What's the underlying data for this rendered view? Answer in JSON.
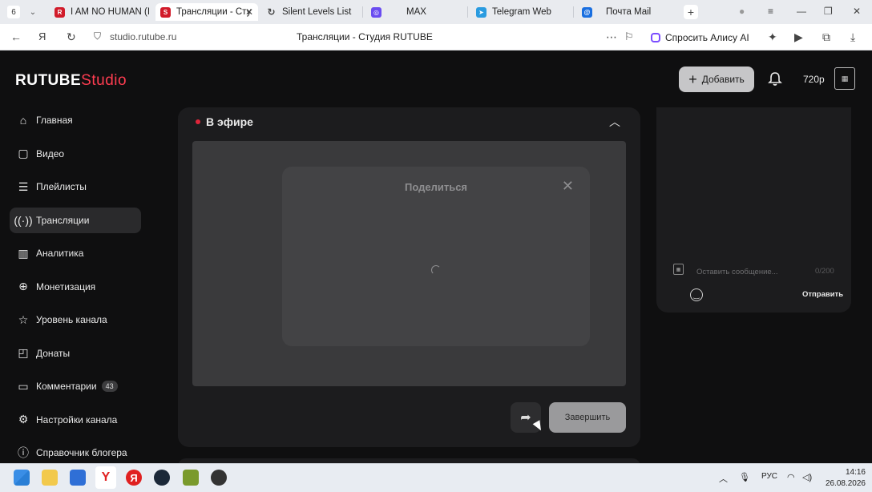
{
  "browser": {
    "tab_counter": "6",
    "tabs": [
      {
        "label": "I AM NO HUMAN (Ir",
        "fav_letter": "R",
        "fav_color": "#d11b2a"
      },
      {
        "label": "Трансляции - Сту",
        "fav_letter": "S",
        "fav_color": "#d11b2a",
        "active": true
      },
      {
        "label": "Silent Levels List",
        "fav_letter": "↻",
        "fav_color": "#444444"
      },
      {
        "label": "MAX",
        "fav_letter": "◎",
        "fav_color": "#6a4cf0"
      },
      {
        "label": "Telegram Web",
        "fav_letter": "➤",
        "fav_color": "#2a9be0"
      },
      {
        "label": "Почта Mail",
        "fav_letter": "@",
        "fav_color": "#1a6fe0"
      }
    ],
    "new_tab": "+",
    "url": "studio.rutube.ru",
    "page_title": "Трансляции - Студия RUTUBE",
    "alice_label": "Спросить Алису AI"
  },
  "header": {
    "logo_main": "RUTUBE",
    "logo_sub": "Studio",
    "add_label": "Добавить",
    "quality": "720p"
  },
  "sidebar": {
    "items": [
      {
        "label": "Главная",
        "icon": "home-icon"
      },
      {
        "label": "Видео",
        "icon": "video-icon"
      },
      {
        "label": "Плейлисты",
        "icon": "playlist-icon"
      },
      {
        "label": "Трансляции",
        "icon": "broadcast-icon",
        "active": true
      },
      {
        "label": "Аналитика",
        "icon": "analytics-icon"
      },
      {
        "label": "Монетизация",
        "icon": "money-icon"
      },
      {
        "label": "Уровень канала",
        "icon": "star-icon"
      },
      {
        "label": "Донаты",
        "icon": "donate-icon"
      },
      {
        "label": "Комментарии",
        "icon": "comment-icon",
        "badge": "43"
      },
      {
        "label": "Настройки канала",
        "icon": "gear-icon"
      },
      {
        "label": "Справочник блогера",
        "icon": "info-icon"
      }
    ]
  },
  "stream": {
    "status": "В эфире",
    "share_title": "Поделиться",
    "finish_label": "Завершить"
  },
  "chat": {
    "placeholder": "Оставить сообщение...",
    "counter": "0/200",
    "send_label": "Отправить"
  },
  "taskbar": {
    "lang": "РУС",
    "time": "14:16",
    "date": "26.08.2026"
  },
  "colors": {
    "accent": "#ff3d51",
    "live": "#e0253a",
    "background": "#0f0f10",
    "card": "#1c1c1e"
  }
}
